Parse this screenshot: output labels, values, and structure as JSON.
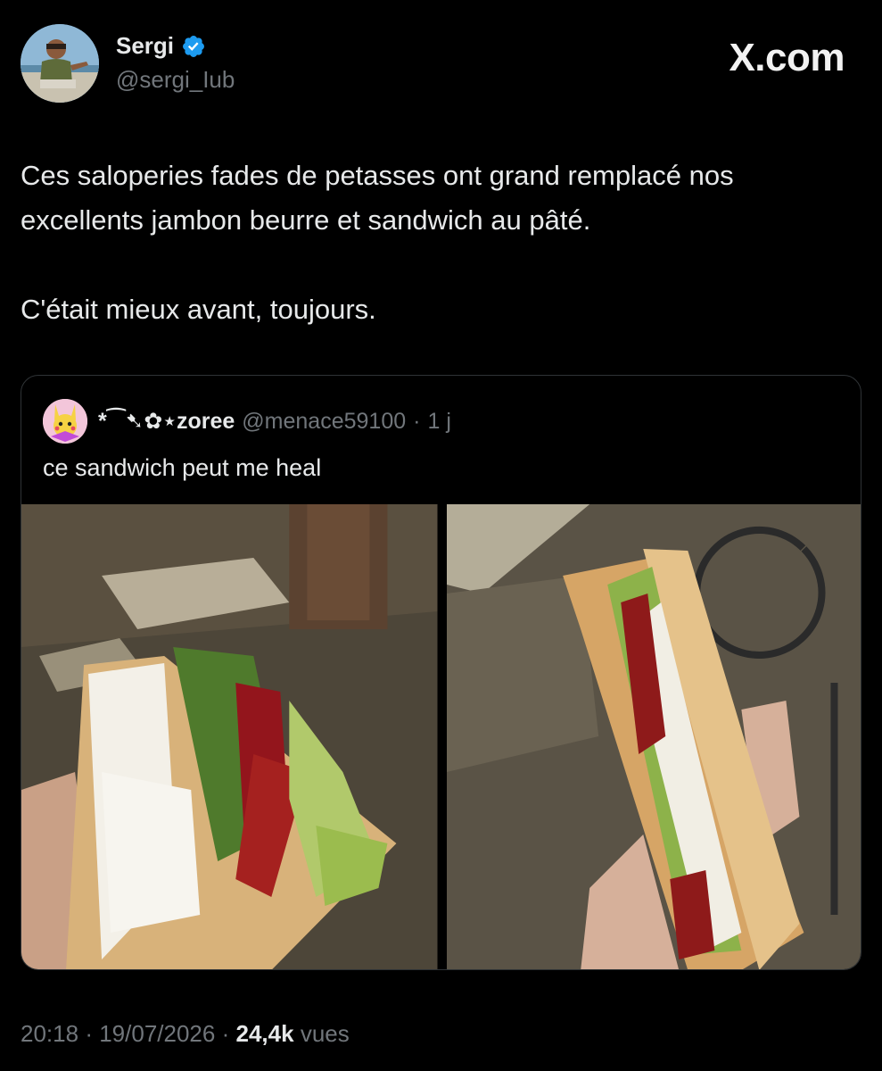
{
  "author": {
    "display_name": "Sergi",
    "handle": "@sergi_Iub",
    "verified": true,
    "verified_color": "#1d9bf0"
  },
  "brand": {
    "label": "X.com"
  },
  "tweet": {
    "paragraph_1_line_1": "Ces saloperies fades de petasses ont grand remplacé nos",
    "paragraph_1_line_2": "excellents jambon beurre et sandwich au pâté.",
    "paragraph_2": "C'était mieux avant, toujours."
  },
  "quoted": {
    "display_name": "*⁀➷✿⋆zoree",
    "handle": "@menace59100",
    "separator": "·",
    "time": "1 j",
    "text": "ce sandwich peut me heal"
  },
  "meta": {
    "time": "20:18",
    "date": "19/07/2026",
    "separator": "·",
    "views_count": "24,4k",
    "views_label": "vues"
  },
  "colors": {
    "background": "#000000",
    "text": "#e7e9ea",
    "muted": "#71767b",
    "border": "#2f3336"
  }
}
